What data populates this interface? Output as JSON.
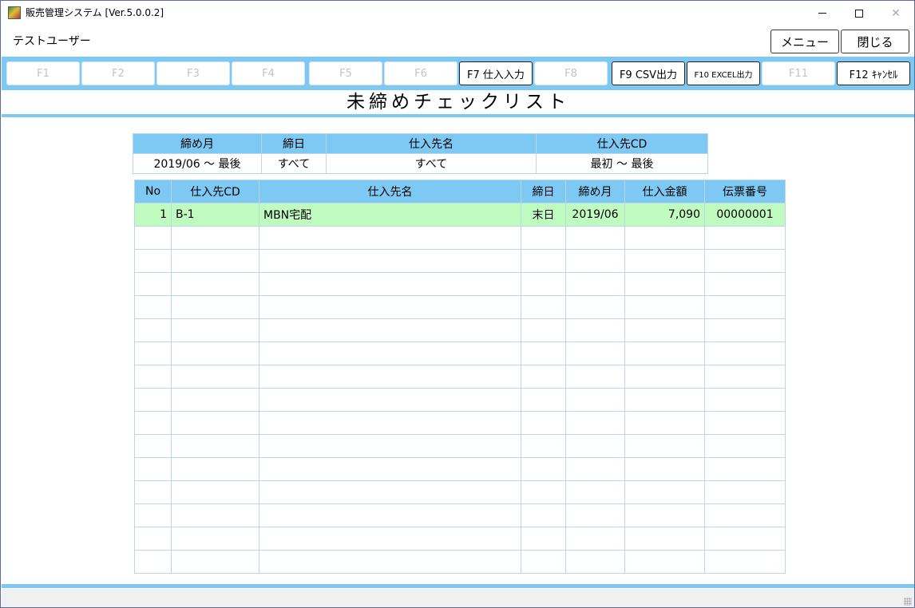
{
  "window": {
    "title": "販売管理システム [Ver.5.0.0.2]",
    "minimize_glyph": "",
    "close_glyph": "✕"
  },
  "header": {
    "user": "テストユーザー",
    "menu_label": "メニュー",
    "close_label": "閉じる"
  },
  "function_keys": [
    {
      "label": "F1",
      "enabled": false
    },
    {
      "label": "F2",
      "enabled": false
    },
    {
      "label": "F3",
      "enabled": false
    },
    {
      "label": "F4",
      "enabled": false
    },
    {
      "label": "F5",
      "enabled": false
    },
    {
      "label": "F6",
      "enabled": false
    },
    {
      "label": "F7 仕入入力",
      "enabled": true
    },
    {
      "label": "F8",
      "enabled": false
    },
    {
      "label": "F9 CSV出力",
      "enabled": true
    },
    {
      "label": "F10 EXCEL出力",
      "enabled": true
    },
    {
      "label": "F11",
      "enabled": false
    },
    {
      "label": "F12 ｷｬﾝｾﾙ",
      "enabled": true
    }
  ],
  "page_title": "未締めチェックリスト",
  "conditions": {
    "headers": [
      "締め月",
      "締日",
      "仕入先名",
      "仕入先CD"
    ],
    "values": [
      "2019/06 〜 最後",
      "すべて",
      "すべて",
      "最初 〜 最後"
    ]
  },
  "list": {
    "headers": [
      "No",
      "仕入先CD",
      "仕入先名",
      "締日",
      "締め月",
      "仕入金額",
      "伝票番号"
    ],
    "rows": [
      [
        "1",
        "B-1",
        "MBN宅配",
        "末日",
        "2019/06",
        "7,090",
        "00000001"
      ]
    ],
    "empty_row_count": 15
  },
  "colors": {
    "accent": "#7ec9f3",
    "selected_row": "#c0fcc0",
    "grid_line": "#b9d6ea"
  }
}
